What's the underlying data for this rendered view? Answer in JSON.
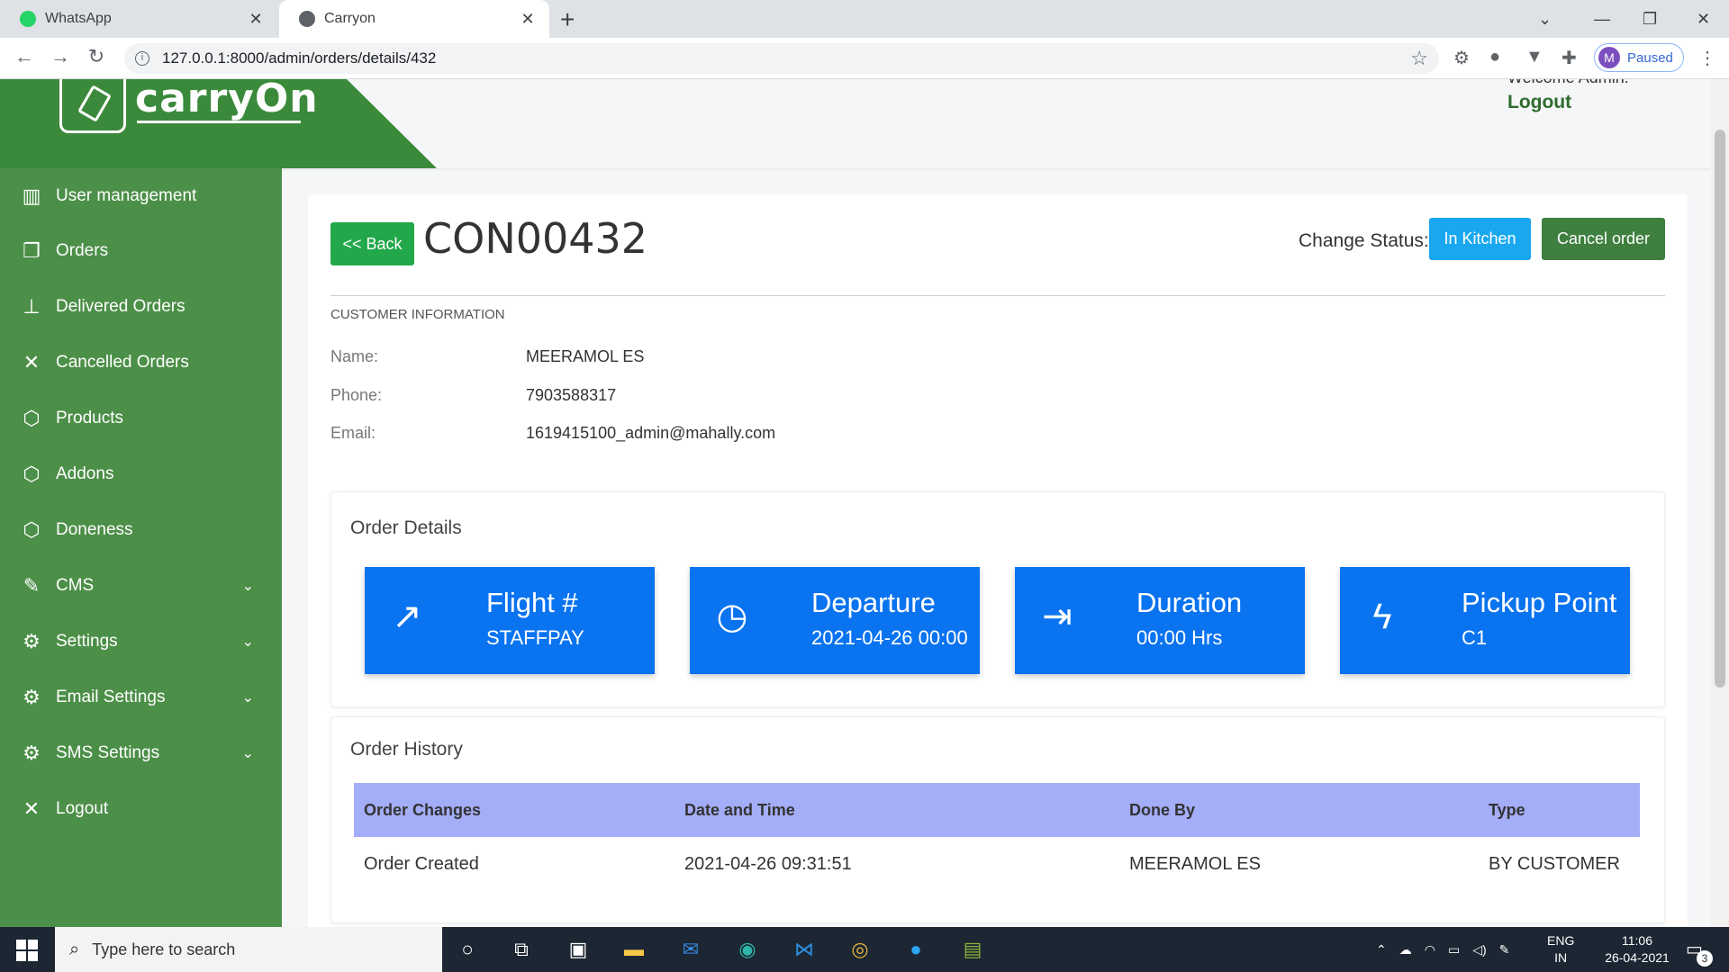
{
  "browser": {
    "tabs": [
      {
        "title": "WhatsApp",
        "favicon_color": "#25d366"
      },
      {
        "title": "Carryon",
        "favicon_color": "#5f6368"
      }
    ],
    "url": "127.0.0.1:8000/admin/orders/details/432",
    "profile_initial": "M",
    "profile_status": "Paused"
  },
  "header": {
    "logo_text": "carryOn",
    "welcome": "Welcome Admin!",
    "logout": "Logout"
  },
  "sidebar": {
    "items": [
      {
        "label": "User management",
        "icon": "chart-bar-icon"
      },
      {
        "label": "Orders",
        "icon": "orders-icon"
      },
      {
        "label": "Delivered Orders",
        "icon": "stamp-icon"
      },
      {
        "label": "Cancelled Orders",
        "icon": "close-icon"
      },
      {
        "label": "Products",
        "icon": "box-icon"
      },
      {
        "label": "Addons",
        "icon": "box-icon"
      },
      {
        "label": "Doneness",
        "icon": "box-icon"
      },
      {
        "label": "CMS",
        "icon": "edit-icon"
      },
      {
        "label": "Settings",
        "icon": "gear-icon"
      },
      {
        "label": "Email Settings",
        "icon": "gear-icon"
      },
      {
        "label": "SMS Settings",
        "icon": "gear-icon"
      },
      {
        "label": "Logout",
        "icon": "close-icon"
      }
    ]
  },
  "order": {
    "back_label": "<< Back",
    "order_id": "CON00432",
    "change_status_label": "Change Status:",
    "in_kitchen_label": "In Kitchen",
    "cancel_label": "Cancel order",
    "customer_section": "CUSTOMER INFORMATION",
    "customer": {
      "name_label": "Name:",
      "name": "MEERAMOL ES",
      "phone_label": "Phone:",
      "phone": "7903588317",
      "email_label": "Email:",
      "email": "1619415100_admin@mahally.com"
    },
    "details_title": "Order Details",
    "stats": [
      {
        "title": "Flight #",
        "value": "STAFFPAY",
        "icon": "trending-up-icon"
      },
      {
        "title": "Departure",
        "value": "2021-04-26 00:00",
        "icon": "clock-icon"
      },
      {
        "title": "Duration",
        "value": "00:00 Hrs",
        "icon": "arrow-to-line-icon"
      },
      {
        "title": "Pickup Point",
        "value": "C1",
        "icon": "lightning-icon"
      }
    ],
    "history_title": "Order History",
    "history_columns": [
      "Order Changes",
      "Date and Time",
      "Done By",
      "Type"
    ],
    "history_rows": [
      [
        "Order Created",
        "2021-04-26 09:31:51",
        "MEERAMOL ES",
        "BY CUSTOMER"
      ]
    ]
  },
  "taskbar": {
    "search_placeholder": "Type here to search",
    "lang": "ENG",
    "region": "IN",
    "time": "11:06",
    "date": "26-04-2021",
    "notifications": "3"
  },
  "colors": {
    "brand_green": "#3b8a3b",
    "sidebar_green": "#4c8f48",
    "stat_blue": "#0a73f0",
    "table_header": "#a4adf8"
  }
}
